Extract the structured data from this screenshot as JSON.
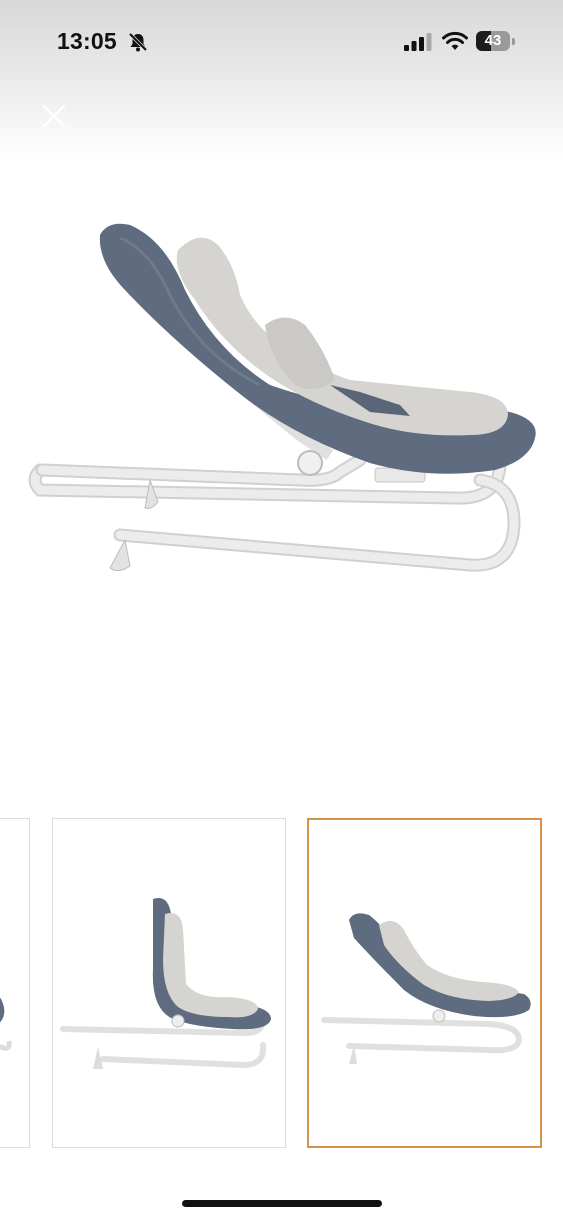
{
  "status_bar": {
    "time": "13:05",
    "battery_level": "43",
    "icons": [
      "bell-slash-icon",
      "cellular-signal-icon",
      "wifi-icon",
      "battery-icon"
    ]
  },
  "viewer": {
    "close_icon": "close-icon",
    "main_image": "product-image-bouncer-side-view",
    "thumbnails": [
      {
        "name": "thumbnail-1",
        "selected": false
      },
      {
        "name": "thumbnail-2",
        "selected": false
      },
      {
        "name": "thumbnail-3",
        "selected": true
      }
    ],
    "selected_color": "#d9904a"
  },
  "colors": {
    "fabric": "#5f6b7e",
    "cushion": "#d6d4d0",
    "frame": "#e8e8e8"
  }
}
